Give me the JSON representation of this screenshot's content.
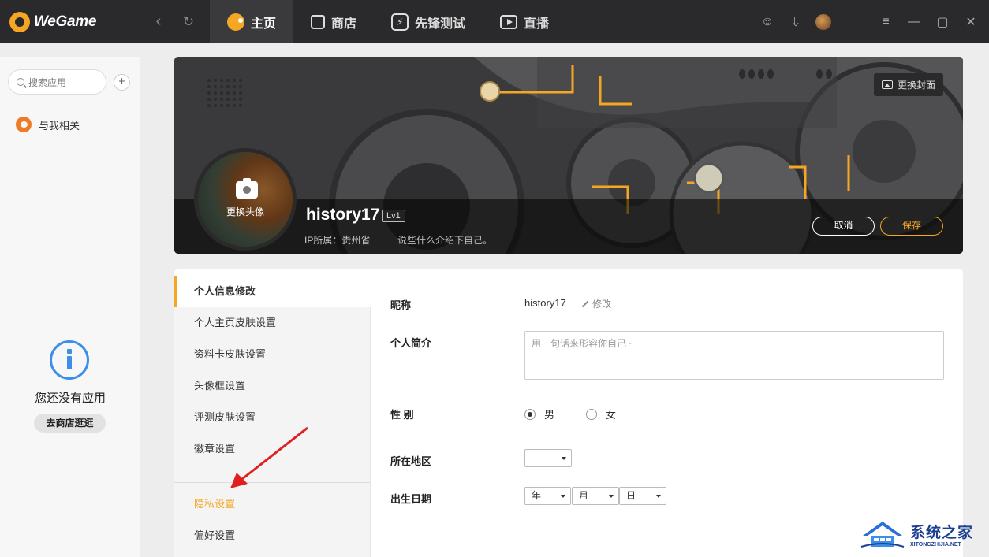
{
  "app": {
    "name": "WeGame"
  },
  "nav": {
    "back": "‹",
    "refresh": "↻",
    "tabs": [
      {
        "label": "主页",
        "active": true
      },
      {
        "label": "商店"
      },
      {
        "label": "先锋测试"
      },
      {
        "label": "直播"
      }
    ]
  },
  "window_controls": {
    "menu": "≡",
    "minimize": "—",
    "maximize": "▢",
    "close": "✕"
  },
  "sidebar": {
    "search_placeholder": "搜索应用",
    "add": "+",
    "items": [
      {
        "label": "与我相关"
      }
    ],
    "empty_text": "您还没有应用",
    "go_shop": "去商店逛逛"
  },
  "banner": {
    "change_cover": "更换封面",
    "change_avatar": "更换头像",
    "username": "history17",
    "level": "Lv1",
    "ip_location": "IP所属：贵州省",
    "bio_placeholder": "说些什么介绍下自己。",
    "cancel": "取消",
    "save": "保存"
  },
  "menu": {
    "items": [
      {
        "label": "个人信息修改",
        "active": true
      },
      {
        "label": "个人主页皮肤设置"
      },
      {
        "label": "资料卡皮肤设置"
      },
      {
        "label": "头像框设置"
      },
      {
        "label": "评测皮肤设置"
      },
      {
        "label": "徽章设置"
      },
      {
        "label": "隐私设置",
        "highlight": true
      },
      {
        "label": "偏好设置"
      }
    ]
  },
  "form": {
    "nickname_label": "昵称",
    "nickname_value": "history17",
    "edit": "修改",
    "bio_label": "个人简介",
    "bio_placeholder": "用一句话来形容你自己~",
    "gender_label": "性 别",
    "gender_options": [
      {
        "label": "男",
        "checked": true
      },
      {
        "label": "女",
        "checked": false
      }
    ],
    "region_label": "所在地区",
    "region_value": "",
    "birth_label": "出生日期",
    "birth_year": "年",
    "birth_month": "月",
    "birth_day": "日"
  },
  "watermark": {
    "cn": "系统之家",
    "en": "XITONGZHIJIA.NET"
  },
  "colors": {
    "accent": "#f5a623",
    "topbar": "#2a2a2c",
    "link_blue": "#3d8ee8",
    "arrow": "#e02020"
  }
}
